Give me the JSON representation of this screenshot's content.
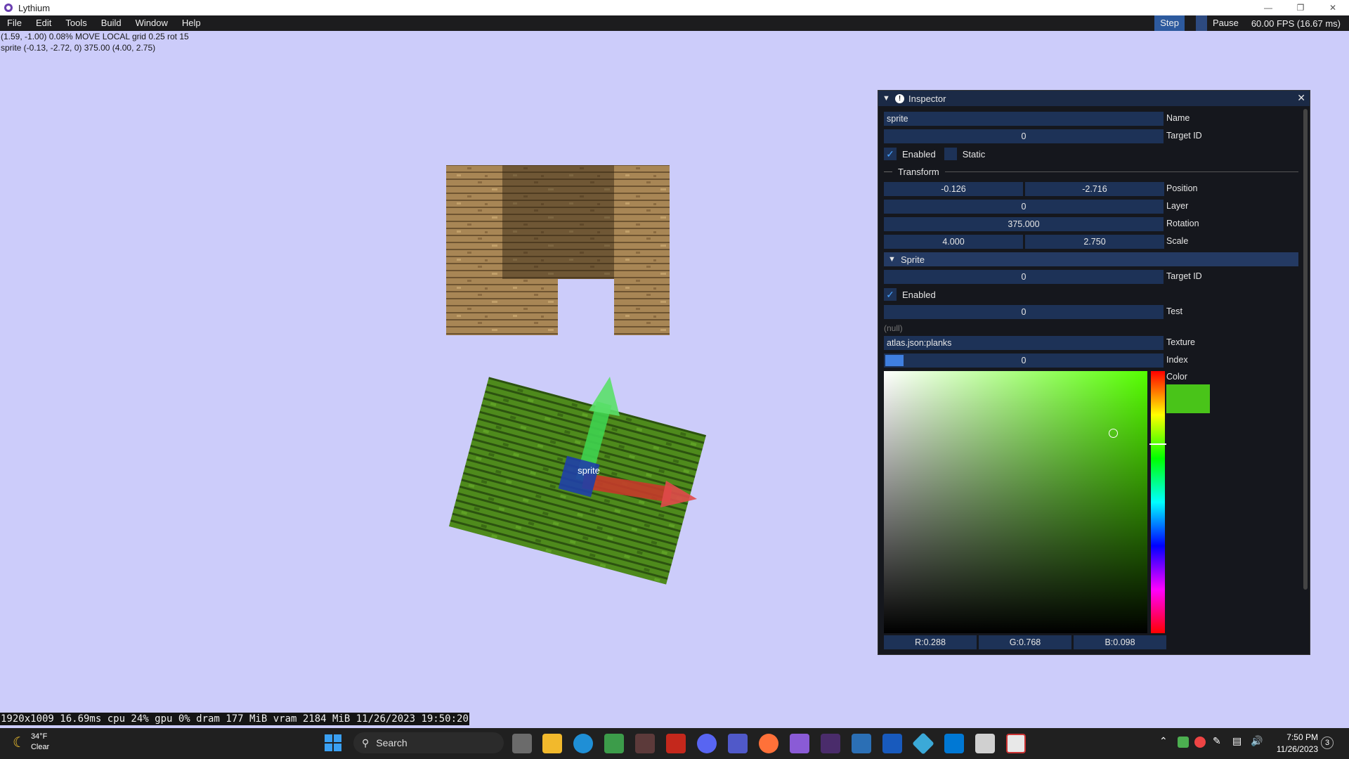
{
  "window": {
    "title": "Lythium",
    "menu": [
      "File",
      "Edit",
      "Tools",
      "Build",
      "Window",
      "Help"
    ],
    "step_label": "Step",
    "pause_label": "Pause",
    "fps": "60.00 FPS (16.67 ms)"
  },
  "overlay": {
    "line1": "(1.59, -1.00) 0.08% MOVE LOCAL grid 0.25 rot 15",
    "line2": "sprite (-0.13, -2.72, 0) 375.00 (4.00, 2.75)"
  },
  "scene": {
    "selected_label": "sprite"
  },
  "inspector": {
    "title": "Inspector",
    "name_value": "sprite",
    "name_label": "Name",
    "target_id_value": "0",
    "target_id_label": "Target ID",
    "enabled_label": "Enabled",
    "static_label": "Static",
    "transform_label": "Transform",
    "position_x": "-0.126",
    "position_y": "-2.716",
    "position_label": "Position",
    "layer_value": "0",
    "layer_label": "Layer",
    "rotation_value": "375.000",
    "rotation_label": "Rotation",
    "scale_x": "4.000",
    "scale_y": "2.750",
    "scale_label": "Scale",
    "sprite_section": "Sprite",
    "sprite_target_id_value": "0",
    "sprite_target_id_label": "Target ID",
    "sprite_enabled_label": "Enabled",
    "test_value": "0",
    "test_label": "Test",
    "null_text": "(null)",
    "texture_value": "atlas.json:planks",
    "texture_label": "Texture",
    "index_value": "0",
    "index_label": "Index",
    "color_label": "Color",
    "r": "R:0.288",
    "g": "G:0.768",
    "b": "B:0.098",
    "color_swatch": "#49c419"
  },
  "status_bar": "1920x1009 16.69ms cpu 24% gpu 0% dram 177 MiB vram 2184 MiB 11/26/2023 19:50:20",
  "taskbar": {
    "weather_temp": "34°F",
    "weather_desc": "Clear",
    "search_placeholder": "Search",
    "time": "7:50 PM",
    "date": "11/26/2023",
    "notification_count": "3"
  }
}
